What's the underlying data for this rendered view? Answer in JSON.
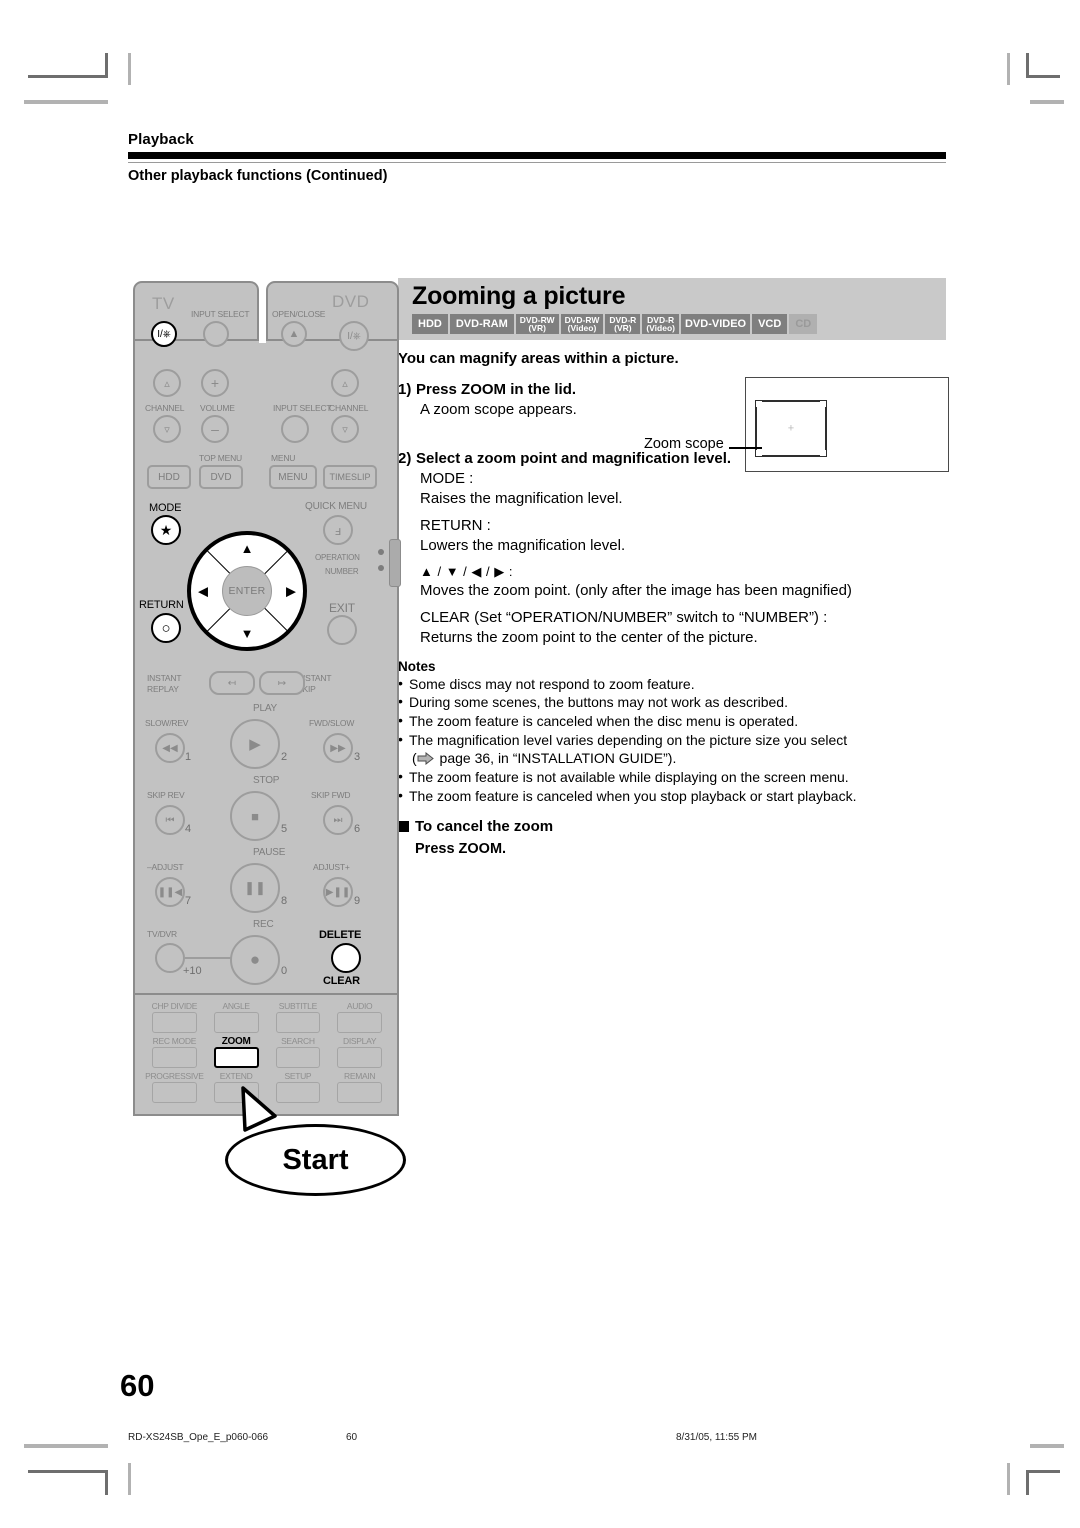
{
  "running_head": {
    "chapter": "Playback",
    "section": "Other playback functions (Continued)"
  },
  "section": {
    "title": "Zooming a picture",
    "badges": [
      {
        "line1": "HDD",
        "line2": "",
        "disabled": false
      },
      {
        "line1": "DVD-RAM",
        "line2": "",
        "disabled": false
      },
      {
        "line1": "DVD-RW",
        "line2": "(VR)",
        "disabled": false
      },
      {
        "line1": "DVD-RW",
        "line2": "(Video)",
        "disabled": false
      },
      {
        "line1": "DVD-R",
        "line2": "(VR)",
        "disabled": false
      },
      {
        "line1": "DVD-R",
        "line2": "(Video)",
        "disabled": false
      },
      {
        "line1": "DVD-VIDEO",
        "line2": "",
        "disabled": false
      },
      {
        "line1": "VCD",
        "line2": "",
        "disabled": false
      },
      {
        "line1": "CD",
        "line2": "",
        "disabled": true
      }
    ]
  },
  "content": {
    "lead": "You can magnify areas within a picture.",
    "step1": {
      "num": "1)",
      "title": "Press ZOOM in the lid.",
      "body": "A zoom scope appears."
    },
    "step2": {
      "num": "2)",
      "title": "Select a zoom point and magnification level.",
      "keys": [
        {
          "key": "MODE :",
          "desc": "Raises the magnification level."
        },
        {
          "key": "RETURN :",
          "desc": "Lowers the magnification level."
        },
        {
          "key": "▲ / ▼ / ◀ / ▶ :",
          "desc": "Moves the zoom point. (only after the image has been magnified)"
        },
        {
          "key": "CLEAR (Set “OPERATION/NUMBER” switch to “NUMBER”) :",
          "desc": "Returns the zoom point to the center of the picture."
        }
      ]
    },
    "notes_title": "Notes",
    "notes": [
      "Some discs may not respond to zoom feature.",
      "During some scenes, the buttons may not work as described.",
      "The zoom feature is canceled when the disc menu is operated.",
      "The magnification level varies depending on the picture size you select",
      "The zoom feature is not available while displaying on the screen menu.",
      "The zoom feature is canceled when you stop playback or start playback."
    ],
    "note_ref_continuation": "page 36, in “INSTALLATION GUIDE”).",
    "cancel": {
      "heading": "To cancel the zoom",
      "body": "Press ZOOM."
    }
  },
  "figure": {
    "scope_label": "Zoom scope",
    "crosshair": "+"
  },
  "remote": {
    "brand_tv": "TV",
    "brand_dvd": "DVD",
    "labels": {
      "input_select": "INPUT SELECT",
      "open_close": "OPEN/CLOSE",
      "channel": "CHANNEL",
      "volume": "VOLUME",
      "top_menu": "TOP MENU",
      "menu": "MENU",
      "hdd": "HDD",
      "dvd": "DVD",
      "menu_btn": "MENU",
      "timeslip": "TIMESLIP",
      "mode": "MODE",
      "quick_menu": "QUICK MENU",
      "operation": "OPERATION",
      "number": "NUMBER",
      "return": "RETURN",
      "exit": "EXIT",
      "enter": "ENTER",
      "instant_replay": "INSTANT\nREPLAY",
      "instant_replay_l1": "INSTANT",
      "instant_replay_l2": "REPLAY",
      "instant_skip_l1": "INSTANT",
      "instant_skip_l2": "SKIP",
      "play": "PLAY",
      "slow_rev": "SLOW/REV",
      "fwd_slow": "FWD/SLOW",
      "stop": "STOP",
      "skip_rev": "SKIP REV",
      "skip_fwd": "SKIP FWD",
      "pause": "PAUSE",
      "adjust_minus": "–ADJUST",
      "adjust_plus": "ADJUST+",
      "tv_dvr": "TV/DVR",
      "rec": "REC",
      "delete": "DELETE",
      "clear": "CLEAR",
      "plus_ten": "+10"
    },
    "numbers": {
      "n1": "1",
      "n2": "2",
      "n3": "3",
      "n4": "4",
      "n5": "5",
      "n6": "6",
      "n7": "7",
      "n8": "8",
      "n9": "9",
      "n0": "0"
    },
    "lid_buttons": [
      {
        "label": "CHP DIVIDE",
        "highlight": false
      },
      {
        "label": "ANGLE",
        "highlight": false
      },
      {
        "label": "SUBTITLE",
        "highlight": false
      },
      {
        "label": "AUDIO",
        "highlight": false
      },
      {
        "label": "REC MODE",
        "highlight": false
      },
      {
        "label": "ZOOM",
        "highlight": true
      },
      {
        "label": "SEARCH",
        "highlight": false
      },
      {
        "label": "DISPLAY",
        "highlight": false
      },
      {
        "label": "PROGRESSIVE",
        "highlight": false
      },
      {
        "label": "EXTEND",
        "highlight": false
      },
      {
        "label": "SETUP",
        "highlight": false
      },
      {
        "label": "REMAIN",
        "highlight": false
      }
    ],
    "callout": "Start"
  },
  "page_number": "60",
  "footer": {
    "file": "RD-XS24SB_Ope_E_p060-066",
    "page": "60",
    "timestamp": "8/31/05, 11:55 PM"
  }
}
